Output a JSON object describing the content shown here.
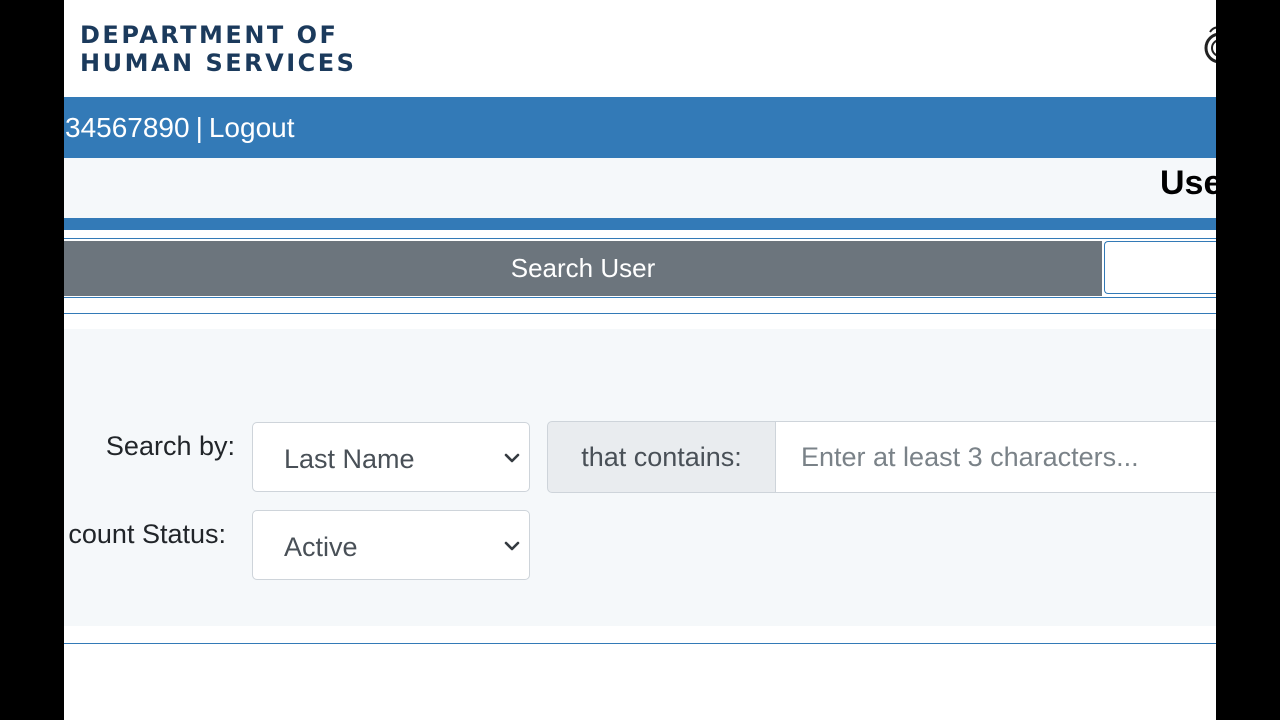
{
  "header": {
    "logo_line1": "DEPARTMENT OF",
    "logo_line2": "HUMAN SERVICES",
    "seal_icon": "state-seal-icon"
  },
  "user_bar": {
    "user_id": "34567890",
    "separator": "|",
    "logout_label": "Logout"
  },
  "page": {
    "title": "Use"
  },
  "tabs": {
    "search_user_label": "Search User",
    "active_tab_color": "#6c757d"
  },
  "search_form": {
    "search_by_label": "Search by:",
    "search_by_value": "Last Name",
    "contains_label": "that contains:",
    "search_placeholder": "Enter at least 3 characters...",
    "search_value": "",
    "account_status_label": "count Status:",
    "account_status_value": "Active"
  },
  "colors": {
    "brand_blue": "#337ab7",
    "logo_navy": "#1b3a5c",
    "panel_bg": "#f5f8fa"
  }
}
